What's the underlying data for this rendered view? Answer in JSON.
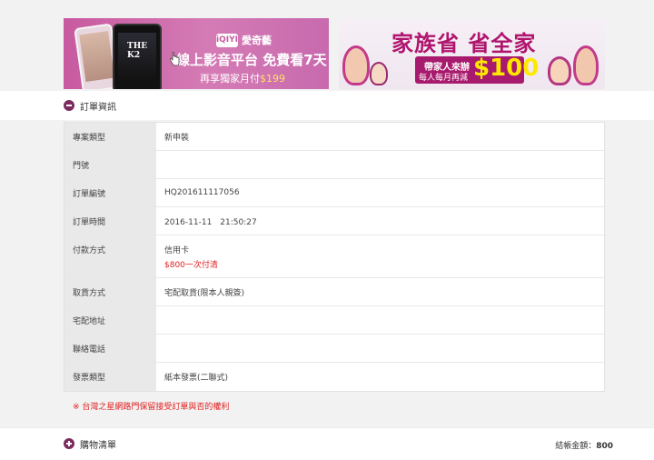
{
  "banners": {
    "left": {
      "brand_logo": "iQIYI",
      "brand_name": "愛奇藝",
      "headline": "線上影音平台 免費看7天",
      "subline": "再享獨家月付",
      "price": "$199",
      "poster_title": "THE K2"
    },
    "right": {
      "headline": "家族省 省全家",
      "line1": "帶家人來辦",
      "line2": "每人每月再減",
      "amount": "$100"
    }
  },
  "order_section": {
    "title": "訂單資訊",
    "rows": [
      {
        "label": "專案類型",
        "value": "新申裝",
        "extra": ""
      },
      {
        "label": "門號",
        "value": "",
        "extra": ""
      },
      {
        "label": "訂單編號",
        "value": "HQ201611117056",
        "extra": ""
      },
      {
        "label": "訂單時間",
        "value": "2016-11-11　21:50:27",
        "extra": ""
      },
      {
        "label": "付款方式",
        "value": "信用卡",
        "extra": "$800一次付清"
      },
      {
        "label": "取貨方式",
        "value": "宅配取貨(限本人親簽)",
        "extra": ""
      },
      {
        "label": "宅配地址",
        "value": "",
        "extra": ""
      },
      {
        "label": "聯絡電話",
        "value": "",
        "extra": ""
      },
      {
        "label": "發票類型",
        "value": "紙本發票(二聯式)",
        "extra": ""
      }
    ],
    "notice": "※ 台灣之星網路門保留接受訂單與否的權利"
  },
  "cart_section": {
    "title": "購物清單",
    "total_label": "結帳金額：",
    "total_value": "800"
  },
  "colors": {
    "accent": "#7b2b5e",
    "warning": "#e02020",
    "label_bg": "#e9e9e9"
  }
}
